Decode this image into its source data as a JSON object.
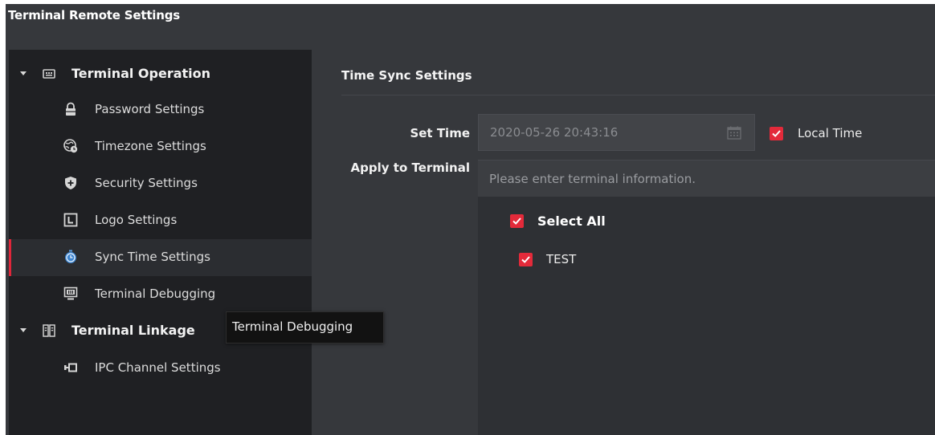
{
  "window": {
    "title": "Terminal Remote Settings"
  },
  "sidebar": {
    "groups": [
      {
        "label": "Terminal Operation",
        "icon": "terminal-device-icon",
        "items": [
          {
            "label": "Password Settings",
            "icon": "lock-icon"
          },
          {
            "label": "Timezone Settings",
            "icon": "globe-clock-icon"
          },
          {
            "label": "Security Settings",
            "icon": "shield-icon"
          },
          {
            "label": "Logo Settings",
            "icon": "logo-icon"
          },
          {
            "label": "Sync Time Settings",
            "icon": "stopwatch-icon",
            "active": true
          },
          {
            "label": "Terminal Debugging",
            "icon": "debug-monitor-icon"
          }
        ]
      },
      {
        "label": "Terminal Linkage",
        "icon": "linkage-icon",
        "items": [
          {
            "label": "IPC Channel Settings",
            "icon": "camera-channel-icon"
          }
        ]
      }
    ]
  },
  "tooltip": {
    "text": "Terminal Debugging"
  },
  "main": {
    "section_title": "Time Sync Settings",
    "set_time": {
      "label": "Set Time",
      "value": "2020-05-26 20:43:16",
      "local_time_label": "Local Time",
      "local_time_checked": true
    },
    "apply_to_terminal": {
      "label": "Apply to Terminal",
      "placeholder": "Please enter terminal information.",
      "select_all_label": "Select All",
      "select_all_checked": true,
      "terminals": [
        {
          "name": "TEST",
          "checked": true
        }
      ]
    }
  },
  "colors": {
    "accent": "#e32a3a",
    "sidebar_bg": "#1f2023",
    "panel_bg": "#36383c",
    "active_item_bg": "#2b2d31"
  }
}
